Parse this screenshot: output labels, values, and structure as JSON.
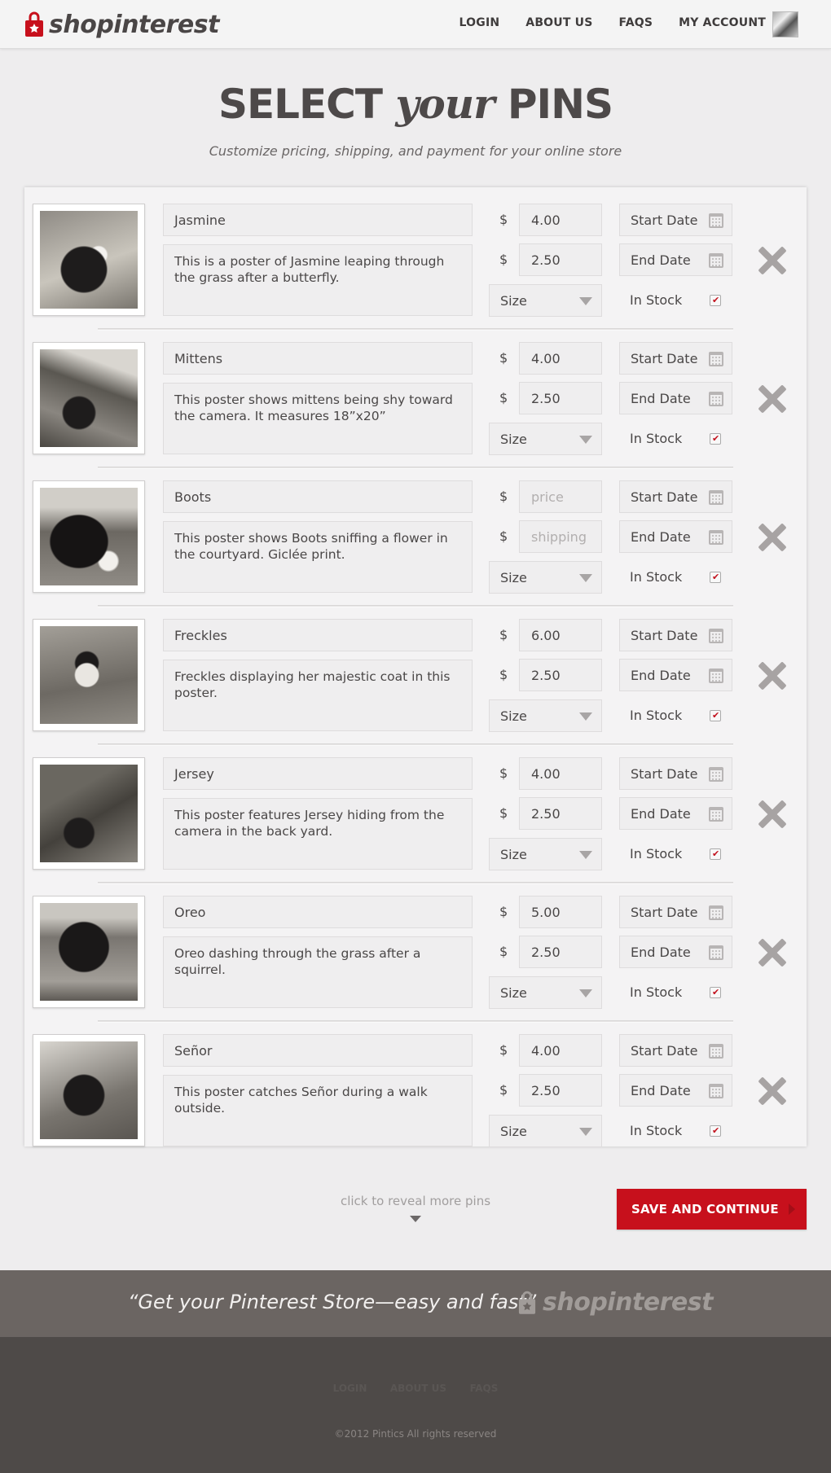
{
  "brand": {
    "name": "shopinterest",
    "colors": {
      "accent": "#c7101c",
      "text_dark": "#4a4646",
      "banner": "#6b6562",
      "footer": "#4e4a48"
    }
  },
  "nav": {
    "items": [
      {
        "label": "LOGIN"
      },
      {
        "label": "ABOUT US"
      },
      {
        "label": "FAQS"
      },
      {
        "label": "MY ACCOUNT"
      }
    ]
  },
  "page": {
    "title_part1": "SELECT ",
    "title_part2": "your",
    "title_part3": " PINS",
    "subtitle": "Customize pricing, shipping, and payment for your online store"
  },
  "form_labels": {
    "currency": "$",
    "price_placeholder": "price",
    "shipping_placeholder": "shipping",
    "size": "Size",
    "start_date": "Start Date",
    "end_date": "End Date",
    "in_stock": "In Stock"
  },
  "pins": [
    {
      "name": "Jasmine",
      "description": "This is a poster of Jasmine leaping through the grass after a butterfly.",
      "price": "4.00",
      "shipping": "2.50",
      "in_stock": true
    },
    {
      "name": "Mittens",
      "description": "This poster shows mittens being shy toward the camera. It measures 18”x20”",
      "price": "4.00",
      "shipping": "2.50",
      "in_stock": true
    },
    {
      "name": "Boots",
      "description": "This poster shows Boots sniffing a flower in the courtyard. Giclée print.",
      "price": "",
      "shipping": "",
      "in_stock": true
    },
    {
      "name": "Freckles",
      "description": "Freckles displaying her majestic coat in this poster.",
      "price": "6.00",
      "shipping": "2.50",
      "in_stock": true
    },
    {
      "name": "Jersey",
      "description": "This poster features Jersey hiding from the camera in the back yard.",
      "price": "4.00",
      "shipping": "2.50",
      "in_stock": true
    },
    {
      "name": "Oreo",
      "description": "Oreo dashing through the grass after a squirrel.",
      "price": "5.00",
      "shipping": "2.50",
      "in_stock": true
    },
    {
      "name": "Señor",
      "description": "This poster catches Señor during a walk outside.",
      "price": "4.00",
      "shipping": "2.50",
      "in_stock": true
    }
  ],
  "actions": {
    "reveal_more": "click to reveal more pins",
    "save": "SAVE AND CONTINUE"
  },
  "banner": {
    "quote": "“Get your Pinterest Store—easy and fast”",
    "logo_text": "shopinterest"
  },
  "footer": {
    "copyright": "©2012 Pintics All rights reserved"
  },
  "icons": [
    "bag-logo-icon",
    "calendar-icon",
    "checkbox-check-icon",
    "remove-x-icon",
    "dropdown-arrow-icon"
  ]
}
